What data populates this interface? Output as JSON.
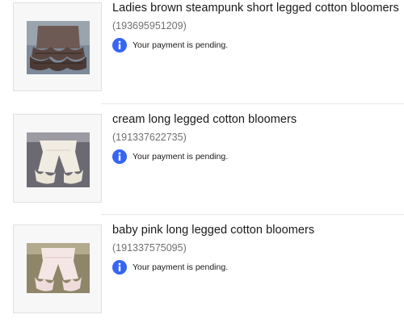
{
  "orders": [
    {
      "title": "Ladies brown steampunk short legged cotton bloomers",
      "item_id": "(193695951209)",
      "status": "Your payment is pending.",
      "status_icon": "info-icon",
      "thumbnail": "brown-ruffled-bloomers-photo"
    },
    {
      "title": "cream long legged cotton bloomers",
      "item_id": "(191337622735)",
      "status": "Your payment is pending.",
      "status_icon": "info-icon",
      "thumbnail": "cream-bloomers-photo"
    },
    {
      "title": "baby pink long legged cotton bloomers",
      "item_id": "(191337575095)",
      "status": "Your payment is pending.",
      "status_icon": "info-icon",
      "thumbnail": "pink-bloomers-photo"
    }
  ],
  "colors": {
    "info_blue": "#3665f3",
    "id_gray": "#707070",
    "text": "#191919"
  }
}
